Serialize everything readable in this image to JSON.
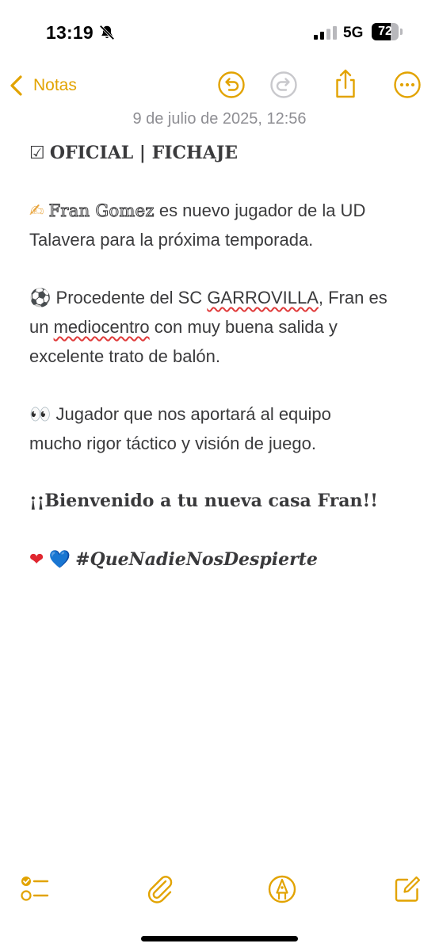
{
  "status_bar": {
    "time": "13:19",
    "network": "5G",
    "battery_percent": "72",
    "battery_level": 0.72
  },
  "nav": {
    "back_label": "Notas",
    "accent_color": "#e2a300"
  },
  "note": {
    "date": "9 de julio de 2025, 12:56",
    "line1_icon": "☑",
    "line1_text": "OFICIAL | FICHAJE",
    "p1_emoji": "✍",
    "p1_name": "Fran Gomez",
    "p1_rest": " es nuevo jugador de la UD",
    "p1_line2": "Talavera para la próxima temporada.",
    "p2_emoji": "⚽",
    "p2_text1": " Procedente del SC ",
    "p2_club": "GARROVILLA",
    "p2_text2": ", Fran es",
    "p2_line2_a": "un ",
    "p2_line2_b": "mediocentro",
    "p2_line2_c": " con muy buena salida y",
    "p2_line3": "excelente trato de balón.",
    "p3_emoji": "👀",
    "p3_line1": " Jugador que nos aportará al equipo",
    "p3_line2": "mucho rigor táctico y visión de juego.",
    "p4_text": "¡¡Bienvenido a tu nueva casa Fran!!",
    "p5_heart_red": "❤",
    "p5_heart_blue": "💙",
    "p5_hashtag": "#QueNadieNosDespierte"
  },
  "icons": {
    "bell_off": "bell-slash-icon",
    "undo": "undo-icon",
    "redo": "redo-icon",
    "share": "share-icon",
    "more": "more-icon",
    "checklist": "checklist-icon",
    "attach": "paperclip-icon",
    "markup": "pen-tip-icon",
    "compose": "compose-icon"
  }
}
